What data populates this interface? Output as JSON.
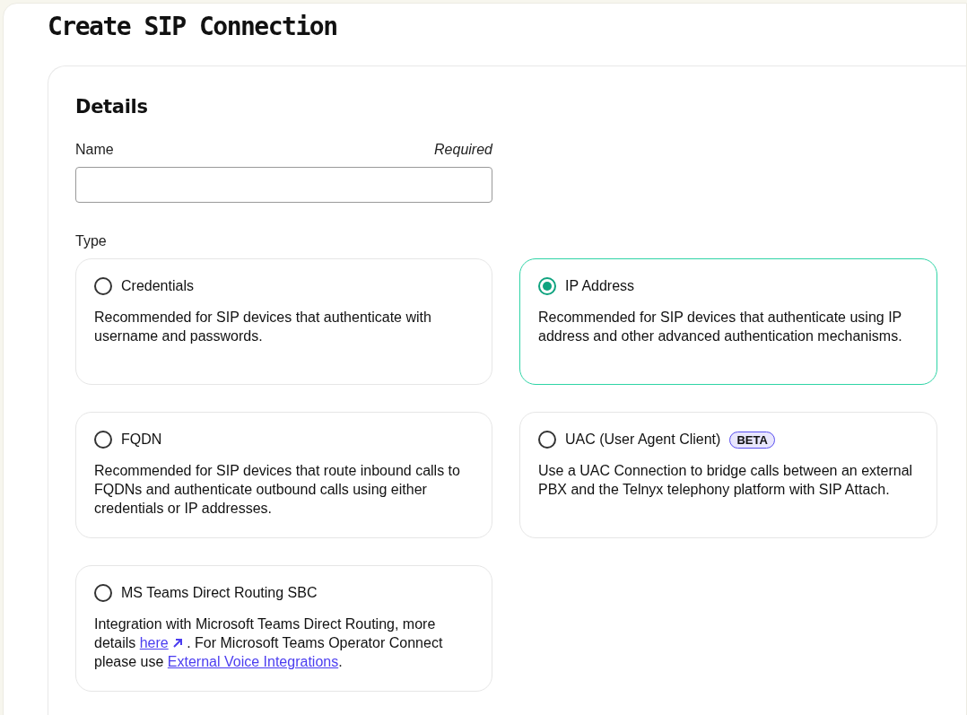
{
  "title": "Create SIP Connection",
  "section": {
    "heading": "Details",
    "name_field": {
      "label": "Name",
      "hint": "Required"
    },
    "type_label": "Type",
    "options": [
      {
        "label": "Credentials",
        "selected": false,
        "description": [
          {
            "kind": "text",
            "text": "Recommended for SIP devices that authenticate with username and passwords."
          }
        ]
      },
      {
        "label": "IP Address",
        "selected": true,
        "description": [
          {
            "kind": "text",
            "text": "Recommended for SIP devices that authenticate using IP address and other advanced authentication mechanisms."
          }
        ]
      },
      {
        "label": "FQDN",
        "selected": false,
        "description": [
          {
            "kind": "text",
            "text": "Recommended for SIP devices that route inbound calls to FQDNs and authenticate outbound calls using either credentials or IP addresses."
          }
        ]
      },
      {
        "label": "UAC (User Agent Client)",
        "badge": "BETA",
        "selected": false,
        "description": [
          {
            "kind": "text",
            "text": "Use a UAC Connection to bridge calls between an external PBX and the Telnyx telephony platform with SIP Attach."
          }
        ]
      },
      {
        "label": "MS Teams Direct Routing SBC",
        "selected": false,
        "description": [
          {
            "kind": "text",
            "text": "Integration with Microsoft Teams Direct Routing, more details "
          },
          {
            "kind": "external_link",
            "text": "here"
          },
          {
            "kind": "text",
            "text": " . For Microsoft Teams Operator Connect please use "
          },
          {
            "kind": "link",
            "text": "External Voice Integrations"
          },
          {
            "kind": "text",
            "text": "."
          }
        ]
      }
    ]
  }
}
